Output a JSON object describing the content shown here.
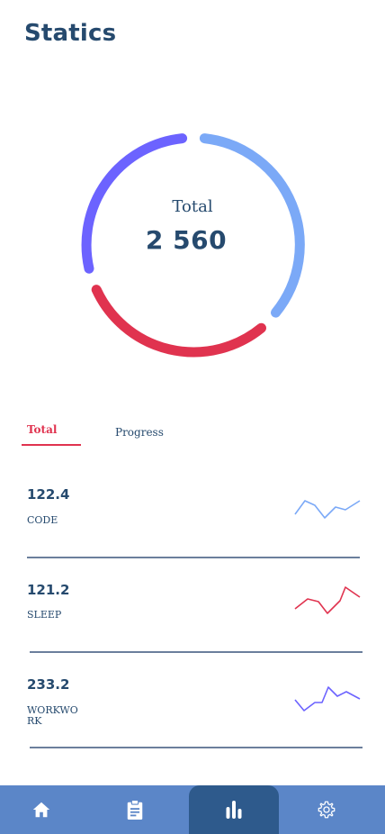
{
  "header": {
    "title": "Statics"
  },
  "summary": {
    "label": "Total",
    "value": "2 560"
  },
  "colors": {
    "code": "#7ba9f7",
    "sleep": "#e0334f",
    "work": "#6c63ff",
    "title": "#264a6e",
    "nav_bg": "#5b86c8",
    "nav_active": "#2e5a8c"
  },
  "tabs": [
    {
      "label": "Total",
      "active": true
    },
    {
      "label": "Progress",
      "active": false
    }
  ],
  "stats": [
    {
      "value": "122.4",
      "label": "CODE"
    },
    {
      "value": "121.2",
      "label": "SLEEP"
    },
    {
      "value": "233.2",
      "label": "WORKWORK"
    }
  ],
  "nav": {
    "items": [
      {
        "icon": "home-icon",
        "active": false
      },
      {
        "icon": "clipboard-icon",
        "active": false
      },
      {
        "icon": "bar-chart-icon",
        "active": true
      },
      {
        "icon": "gear-icon",
        "active": false
      }
    ]
  }
}
